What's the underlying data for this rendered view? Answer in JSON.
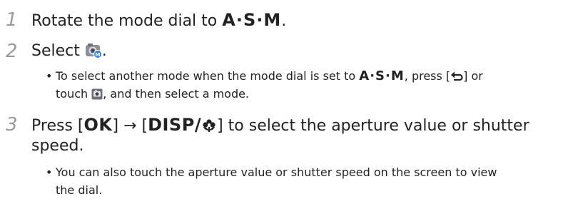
{
  "steps": [
    {
      "number": "1",
      "text": "Rotate the mode dial to",
      "mode": "A·S·M",
      "end": "."
    },
    {
      "number": "2",
      "text": "Select",
      "end": ".",
      "icon": "camera-mode-icon"
    },
    {
      "number": "3",
      "text_before": "Press [",
      "ok_key": "OK",
      "arrow_mid": "] → [",
      "disp_key": "DISP",
      "slash": "/",
      "text_after": "] to select the aperture value or shutter",
      "line2": "speed."
    }
  ],
  "bullets": [
    {
      "part1": "To select another mode when the mode dial is set to",
      "mode": "A·S·M",
      "part2": ", press [",
      "part3": "] or",
      "line2_a": "touch",
      "line2_b": ", and then select a mode."
    },
    {
      "line1": "You can also touch the aperture value or shutter speed on the screen to view",
      "line2": "the dial."
    }
  ],
  "bullet_char": "•",
  "icons": {
    "back": "back-arrow-icon",
    "touch": "touch-mode-icon",
    "macro": "macro-flower-icon"
  },
  "colors": {
    "step_number": "#9a9a9a",
    "text": "#222222",
    "icon_blue": "#3b7fd0"
  }
}
